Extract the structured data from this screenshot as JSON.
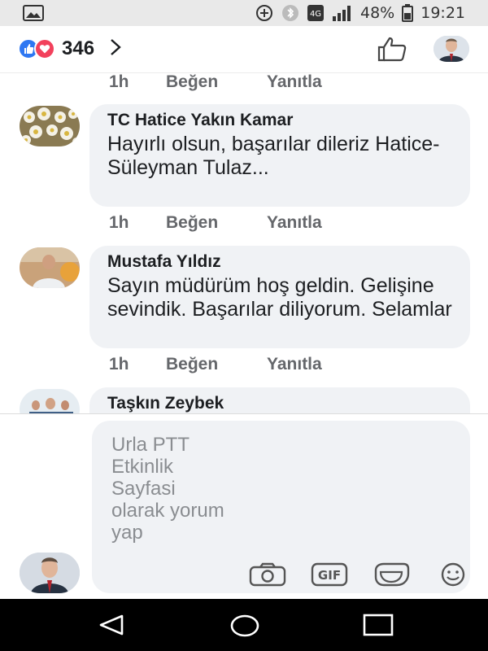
{
  "status_bar": {
    "battery": "48%",
    "time": "19:21",
    "network_label": "4G"
  },
  "reactions": {
    "count": "346",
    "types": [
      "like-icon",
      "love-icon"
    ],
    "like_color": "#2e77f2",
    "love_color": "#f2415c"
  },
  "comments": [
    {
      "author": "",
      "text": "",
      "time": "1h",
      "like_label": "Beğen",
      "reply_label": "Yanıtla"
    },
    {
      "author": "TC Hatice Yakın Kamar",
      "text": "Hayırlı olsun, başarılar dileriz Hatice-Süleyman Tulaz...",
      "time": "1h",
      "like_label": "Beğen",
      "reply_label": "Yanıtla"
    },
    {
      "author": "Mustafa Yıldız",
      "text": "Sayın müdürüm hoş geldin. Gelişine sevindik. Başarılar diliyorum. Selamlar",
      "time": "1h",
      "like_label": "Beğen",
      "reply_label": "Yanıtla"
    },
    {
      "author": "Taşkın Zeybek",
      "text": ""
    }
  ],
  "composer": {
    "placeholder": "Urla PTT Etkinlik Sayfasi olarak yorum yap",
    "tools": [
      "camera-icon",
      "gif-icon",
      "sticker-icon",
      "emoji-icon"
    ],
    "gif_label": "GIF"
  },
  "colors": {
    "bubble": "#f0f2f5",
    "meta_text": "#65676b",
    "navbar": "#000000"
  }
}
